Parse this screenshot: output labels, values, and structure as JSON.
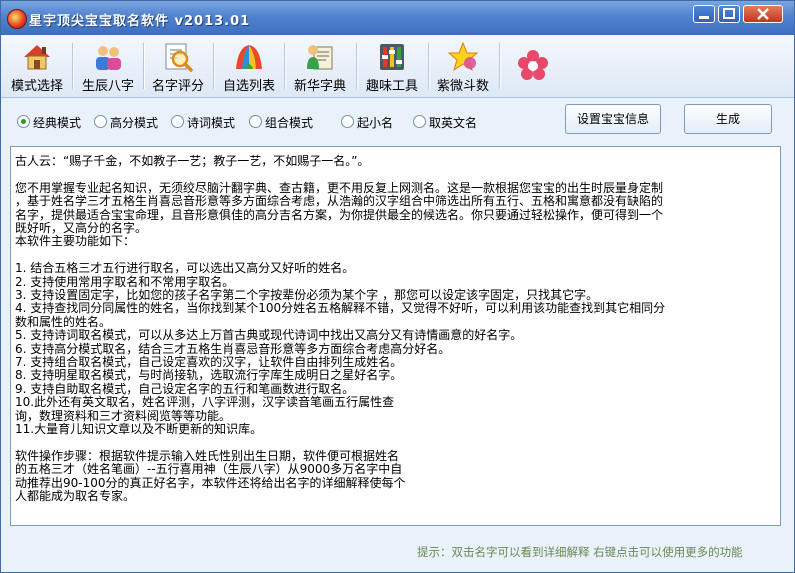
{
  "window": {
    "title": "星宇顶尖宝宝取名软件 v2013.01"
  },
  "toolbar": {
    "items": [
      {
        "label": "模式选择",
        "icon": "house-icon"
      },
      {
        "label": "生辰八字",
        "icon": "people-icon"
      },
      {
        "label": "名字评分",
        "icon": "magnifier-icon"
      },
      {
        "label": "自选列表",
        "icon": "tent-icon"
      },
      {
        "label": "新华字典",
        "icon": "dictionary-icon"
      },
      {
        "label": "趣味工具",
        "icon": "tools-icon"
      },
      {
        "label": "紫微斗数",
        "icon": "star-icon"
      },
      {
        "label": "",
        "icon": "flower-icon"
      }
    ]
  },
  "modes": {
    "options": [
      {
        "label": "经典模式",
        "selected": true
      },
      {
        "label": "高分模式",
        "selected": false
      },
      {
        "label": "诗词模式",
        "selected": false
      },
      {
        "label": "组合模式",
        "selected": false
      },
      {
        "label": "起小名",
        "selected": false
      },
      {
        "label": "取英文名",
        "selected": false
      }
    ],
    "set_info_label": "设置宝宝信息",
    "generate_label": "生成"
  },
  "content": {
    "lines": [
      "古人云：“赐子千金，不如教子一艺；教子一艺，不如赐子一名。”。",
      "",
      "您不用掌握专业起名知识，无须绞尽脑汁翻字典、查古籍，更不用反复上网测名。这是一款根据您宝宝的出生时辰量身定制",
      "，基于姓名学三才五格生肖喜忌音形意等多方面综合考虑，从浩瀚的汉字组合中筛选出所有五行、五格和寓意都没有缺陷的",
      "名字，提供最适合宝宝命理，且音形意俱佳的高分吉名方案，为你提供最全的候选名。你只要通过轻松操作，便可得到一个",
      "既好听，又高分的名字。",
      "本软件主要功能如下：",
      "",
      "1. 结合五格三才五行进行取名，可以选出又高分又好听的姓名。",
      "2. 支持使用常用字取名和不常用字取名。",
      "3. 支持设置固定字，比如您的孩子名字第二个字按辈份必须为某个字 ，那您可以设定该字固定，只找其它字。",
      "4. 支持查找同分同属性的姓名，当你找到某个100分姓名五格解释不错，又觉得不好听，可以利用该功能查找到其它相同分",
      "数和属性的姓名。",
      "5. 支持诗词取名模式，可以从多达上万首古典或现代诗词中找出又高分又有诗情画意的好名字。",
      "6. 支持高分模式取名，结合三才五格生肖喜忌音形意等多方面综合考虑高分好名。",
      "7. 支持组合取名模式，自己设定喜欢的汉字，让软件自由排列生成姓名。",
      "8. 支持明星取名模式，与时尚接轨，选取流行字库生成明日之星好名字。",
      "9. 支持自助取名模式，自己设定名字的五行和笔画数进行取名。",
      "10.此外还有英文取名，姓名评测，八字评测，汉字读音笔画五行属性查",
      "询，数理资料和三才资料阅览等等功能。",
      "11.大量育儿知识文章以及不断更新的知识库。",
      "",
      "软件操作步骤：根据软件提示输入姓氏性别出生日期，软件便可根据姓名",
      "的五格三才（姓名笔画）--五行喜用神（生辰八字）从9000多万名字中自",
      "动推荐出90-100分的真正好名字，本软件还将给出名字的详细解释使每个",
      "人都能成为取名专家。"
    ]
  },
  "status": {
    "hint": "提示：双击名字可以看到详细解释   右键点击可以使用更多的功能"
  }
}
